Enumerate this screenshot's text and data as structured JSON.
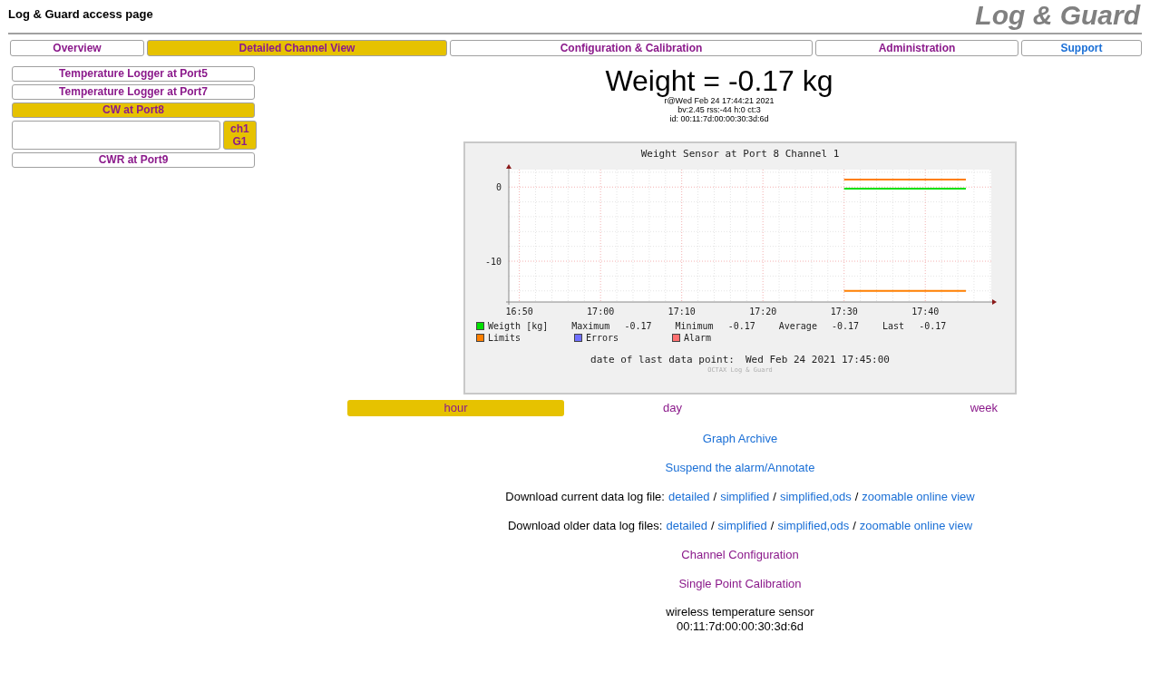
{
  "header": {
    "title": "Log & Guard access page",
    "logo": "Log & Guard"
  },
  "nav_tabs": [
    {
      "label": "Overview",
      "selected": false,
      "kind": "page"
    },
    {
      "label": "Detailed Channel View",
      "selected": true,
      "kind": "page"
    },
    {
      "label": "Configuration & Calibration",
      "selected": false,
      "kind": "page"
    },
    {
      "label": "Administration",
      "selected": false,
      "kind": "page"
    },
    {
      "label": "Support",
      "selected": false,
      "kind": "external"
    }
  ],
  "sidebar": {
    "items": [
      {
        "label": "Temperature Logger at Port5",
        "selected": false
      },
      {
        "label": "Temperature Logger at Port7",
        "selected": false
      },
      {
        "label": "CW at Port8",
        "selected": true,
        "channels": [
          {
            "label": "ch1\nG1",
            "selected": true
          }
        ]
      },
      {
        "label": "CWR at Port9",
        "selected": false
      }
    ]
  },
  "reading": {
    "value": "Weight = -0.17 kg",
    "lines": [
      "r@Wed Feb 24 17:44:21 2021",
      "bv:2.45 rss:-44 h:0 ct:3",
      "id: 00:11:7d:00:00:30:3d:6d"
    ]
  },
  "graph": {
    "chart_data": {
      "type": "line",
      "title": "Weight Sensor at Port 8 Channel 1",
      "categories": [
        "16:50",
        null,
        "17:00",
        null,
        "17:10",
        null,
        "17:20",
        null,
        "17:30",
        null,
        "17:40",
        null
      ],
      "series": [
        {
          "name": "Weigth [kg]",
          "color": "#00e000",
          "values": [
            null,
            null,
            null,
            null,
            null,
            null,
            null,
            null,
            -0.2,
            -0.2,
            -0.2,
            -0.2
          ]
        },
        {
          "name": "Limits",
          "color": "#ff7f00",
          "values": [
            null,
            null,
            null,
            null,
            null,
            null,
            null,
            null,
            1,
            1,
            1,
            1
          ]
        },
        {
          "color": "#ff7f00",
          "values": [
            null,
            null,
            null,
            null,
            null,
            null,
            null,
            null,
            -14,
            -14,
            -14,
            -14
          ]
        }
      ],
      "ylim": [
        -15.5,
        2.6
      ],
      "grid": true,
      "yticks": [
        0,
        -10
      ]
    },
    "stats": [
      {
        "label": "Maximum",
        "value": "-0.17"
      },
      {
        "label": "Minimum",
        "value": "-0.17"
      },
      {
        "label": "Average",
        "value": "-0.17"
      },
      {
        "label": "Last",
        "value": "-0.17"
      }
    ],
    "legend": [
      {
        "label": "Errors",
        "color": "#7070ff"
      },
      {
        "label": "Alarm",
        "color": "#ff7070"
      }
    ],
    "last_point": {
      "label": "date of last data point:",
      "value": "Wed Feb 24 2021 17:45:00"
    },
    "credit": "OCTAX Log & Guard"
  },
  "periods": [
    {
      "label": "hour",
      "selected": true
    },
    {
      "label": "day",
      "selected": false
    },
    {
      "label": "week",
      "selected": false
    }
  ],
  "links": [
    {
      "kind": "link",
      "label": "Graph Archive",
      "color": "#1a6fd6"
    },
    {
      "kind": "link",
      "label": "Suspend the alarm/Annotate",
      "color": "#1a6fd6"
    },
    {
      "kind": "downloads",
      "label": "Download current data log file:",
      "items": [
        "detailed",
        "simplified",
        "simplified,ods",
        "zoomable online view"
      ],
      "separator": "/"
    },
    {
      "kind": "downloads",
      "label": "Download older data log files:",
      "items": [
        "detailed",
        "simplified",
        "simplified,ods",
        "zoomable online view"
      ],
      "separator": "/"
    },
    {
      "kind": "link",
      "label": "Channel Configuration",
      "color": "#8b1a8b"
    },
    {
      "kind": "link",
      "label": "Single Point Calibration",
      "color": "#8b1a8b"
    }
  ],
  "sensor": {
    "lines": [
      "wireless temperature sensor",
      "00:11:7d:00:00:30:3d:6d"
    ]
  }
}
